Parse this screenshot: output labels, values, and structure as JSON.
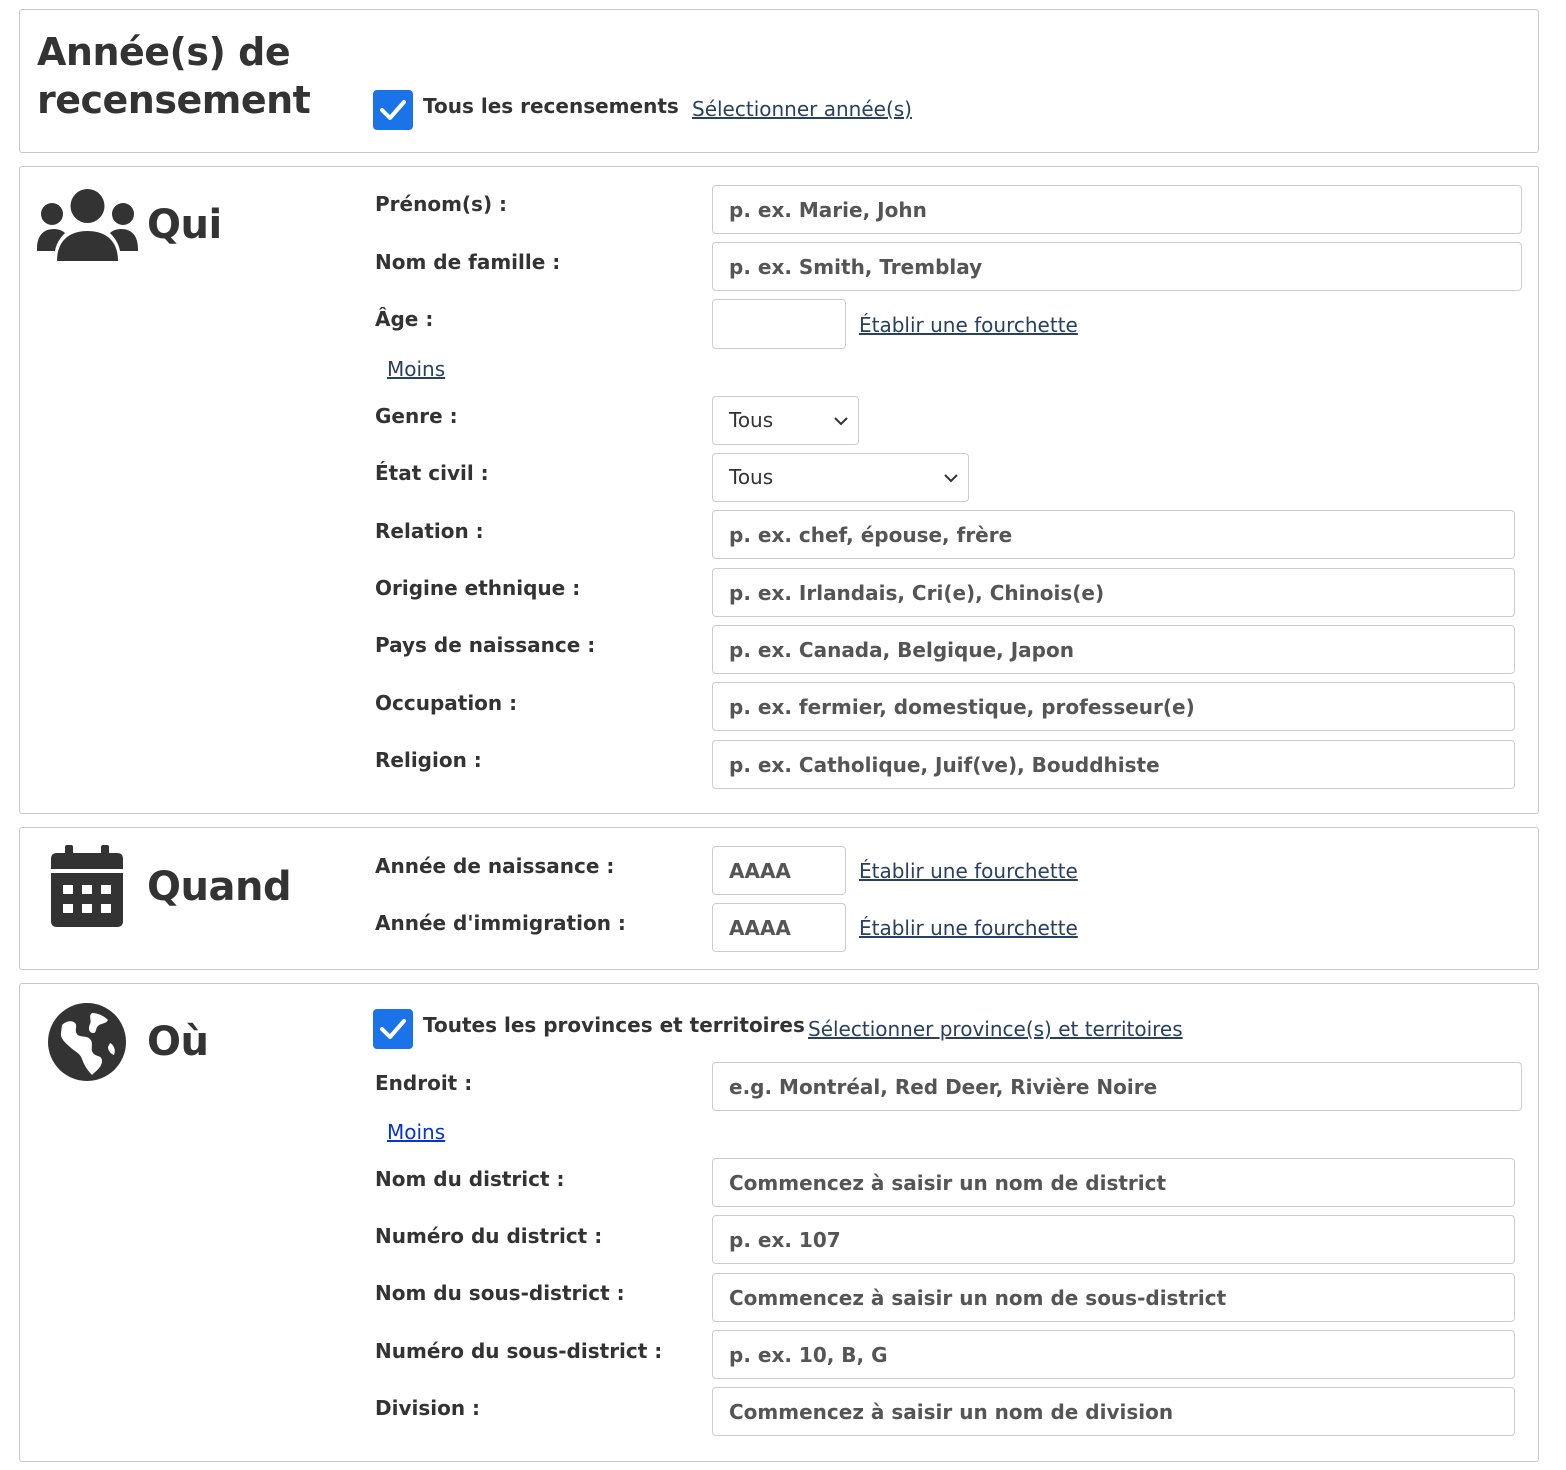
{
  "years": {
    "title_line1": "Année(s) de",
    "title_line2": "recensement",
    "all_censuses_label": "Tous les recensements",
    "all_censuses_checked": true,
    "select_years_link": "Sélectionner année(s)"
  },
  "qui": {
    "title": "Qui",
    "icon": "users-icon",
    "first_name": {
      "label": "Prénom(s) :",
      "placeholder": "p. ex. Marie, John",
      "value": ""
    },
    "last_name": {
      "label": "Nom de famille :",
      "placeholder": "p. ex. Smith, Tremblay",
      "value": ""
    },
    "age": {
      "label": "Âge :",
      "value": "",
      "range_link": "Établir une fourchette"
    },
    "less_link": "Moins",
    "gender": {
      "label": "Genre :",
      "selected": "Tous"
    },
    "marital_status": {
      "label": "État civil :",
      "selected": "Tous"
    },
    "relation": {
      "label": "Relation :",
      "placeholder": "p. ex. chef, épouse, frère"
    },
    "ethnic_origin": {
      "label": "Origine ethnique :",
      "placeholder": "p. ex. Irlandais, Cri(e), Chinois(e)"
    },
    "birth_country": {
      "label": "Pays de naissance :",
      "placeholder": "p. ex. Canada, Belgique, Japon"
    },
    "occupation": {
      "label": "Occupation :",
      "placeholder": "p. ex. fermier, domestique, professeur(e)"
    },
    "religion": {
      "label": "Religion :",
      "placeholder": "p. ex. Catholique, Juif(ve), Bouddhiste"
    }
  },
  "quand": {
    "title": "Quand",
    "icon": "calendar-icon",
    "birth_year": {
      "label": "Année de naissance :",
      "placeholder": "AAAA",
      "range_link": "Établir une fourchette"
    },
    "immigration_year": {
      "label": "Année d'immigration :",
      "placeholder": "AAAA",
      "range_link": "Établir une fourchette"
    }
  },
  "ou": {
    "title": "Où",
    "icon": "globe-icon",
    "all_provinces_label": "Toutes les provinces et territoires",
    "all_provinces_checked": true,
    "select_provinces_link": "Sélectionner province(s) et territoires",
    "place": {
      "label": "Endroit :",
      "placeholder": "e.g. Montréal, Red Deer, Rivière Noire"
    },
    "less_link": "Moins",
    "district_name": {
      "label": "Nom du district :",
      "placeholder": "Commencez à saisir un nom de district"
    },
    "district_number": {
      "label": "Numéro du district :",
      "placeholder": "p. ex. 107"
    },
    "subdistrict_name": {
      "label": "Nom du sous-district :",
      "placeholder": "Commencez à saisir un nom de sous-district"
    },
    "subdistrict_number": {
      "label": "Numéro du sous-district :",
      "placeholder": "p. ex. 10, B, G"
    },
    "division": {
      "label": "Division :",
      "placeholder": "Commencez à saisir un nom de division"
    }
  },
  "colors": {
    "checkbox": "#1a73e8",
    "link": "#284162",
    "link_visited_blue": "#0535d2",
    "text": "#333333",
    "border": "#c8c8c8"
  }
}
